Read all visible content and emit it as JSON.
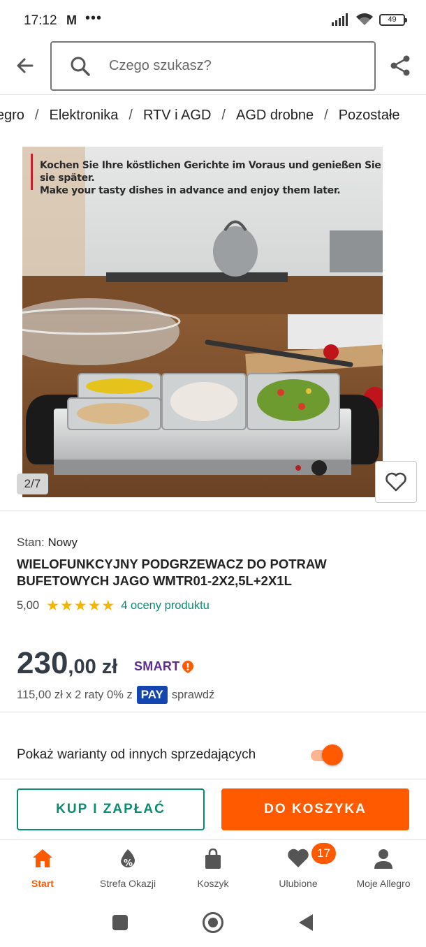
{
  "status_bar": {
    "time": "17:12",
    "mail_icon": "M",
    "more": "•••",
    "battery": "49"
  },
  "search": {
    "placeholder": "Czego szukasz?"
  },
  "breadcrumb": [
    "llegro",
    "Elektronika",
    "RTV i AGD",
    "AGD drobne",
    "Pozostałe"
  ],
  "breadcrumb_separator": "/",
  "gallery": {
    "caption_line1": "Kochen Sie Ihre köstlichen Gerichte im Voraus und genießen Sie sie später.",
    "caption_line2": "Make your tasty dishes in advance and enjoy them later.",
    "counter": "2/7"
  },
  "product": {
    "condition_label": "Stan:",
    "condition_value": "Nowy",
    "title": "WIELOFUNKCYJNY PODGRZEWACZ DO POTRAW BUFETOWYCH JAGO WMTR01-2X2,5L+2X1L",
    "rating_score": "5,00",
    "rating_stars": "★★★★★",
    "rating_link": "4 oceny produktu"
  },
  "price": {
    "main": "230",
    "fraction": ",00 zł",
    "smart_label": "SMART",
    "installments_text": "115,00 zł x 2 raty 0% z",
    "pay_label": "PAY",
    "check_link": "sprawdź"
  },
  "variants": {
    "label": "Pokaż warianty od innych sprzedających",
    "toggle_on": true
  },
  "actions": {
    "buy_label": "KUP I ZAPŁAĆ",
    "cart_label": "DO KOSZYKA"
  },
  "tabbar": {
    "items": [
      {
        "label": "Start",
        "icon": "home-icon",
        "active": true
      },
      {
        "label": "Strefa Okazji",
        "icon": "discount-icon",
        "active": false
      },
      {
        "label": "Koszyk",
        "icon": "bag-icon",
        "active": false
      },
      {
        "label": "Ulubione",
        "icon": "heart-icon",
        "active": false
      },
      {
        "label": "Moje Allegro",
        "icon": "person-icon",
        "active": false
      }
    ],
    "favorites_badge": "17"
  },
  "colors": {
    "accent": "#ff5a00",
    "teal": "#0a8c72",
    "pay_blue": "#1546b0",
    "smart_purple": "#5d2b8c",
    "stars": "#f5b400"
  }
}
